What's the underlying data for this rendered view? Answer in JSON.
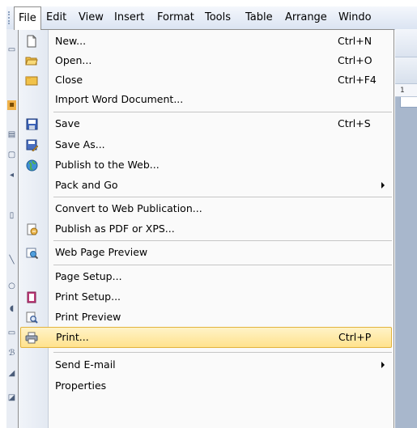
{
  "menubar": {
    "items": [
      {
        "label": "File"
      },
      {
        "label": "Edit"
      },
      {
        "label": "View"
      },
      {
        "label": "Insert"
      },
      {
        "label": "Format"
      },
      {
        "label": "Tools"
      },
      {
        "label": "Table"
      },
      {
        "label": "Arrange"
      },
      {
        "label": "Windo"
      }
    ]
  },
  "file_menu": {
    "items": [
      {
        "label": "New...",
        "shortcut": "Ctrl+N",
        "icon": "new-document-icon"
      },
      {
        "label": "Open...",
        "shortcut": "Ctrl+O",
        "icon": "open-folder-icon"
      },
      {
        "label": "Close",
        "shortcut": "Ctrl+F4",
        "icon": "close-folder-icon"
      },
      {
        "label": "Import Word Document...",
        "shortcut": ""
      },
      {
        "label": "Save",
        "shortcut": "Ctrl+S",
        "icon": "save-disk-icon"
      },
      {
        "label": "Save As...",
        "shortcut": "",
        "icon": "save-as-icon"
      },
      {
        "label": "Publish to the Web...",
        "shortcut": "",
        "icon": "globe-icon"
      },
      {
        "label": "Pack and Go",
        "shortcut": "",
        "submenu": true
      },
      {
        "label": "Convert to Web Publication...",
        "shortcut": ""
      },
      {
        "label": "Publish as PDF or XPS...",
        "shortcut": "",
        "icon": "pdf-export-icon"
      },
      {
        "label": "Web Page Preview",
        "shortcut": "",
        "icon": "web-preview-icon"
      },
      {
        "label": "Page Setup...",
        "shortcut": ""
      },
      {
        "label": "Print Setup...",
        "shortcut": "",
        "icon": "print-setup-icon"
      },
      {
        "label": "Print Preview",
        "shortcut": "",
        "icon": "print-preview-icon"
      },
      {
        "label": "Print...",
        "shortcut": "Ctrl+P",
        "icon": "printer-icon",
        "highlighted": true
      },
      {
        "label": "Send E-mail",
        "shortcut": "",
        "submenu": true
      },
      {
        "label": "Properties",
        "shortcut": ""
      }
    ]
  },
  "background": {
    "ruler_text": "1"
  },
  "colors": {
    "highlight_fill": "#ffe28d",
    "highlight_border": "#e2b33d",
    "menubar_bg": "#dbe4f2",
    "app_bg": "#a8b7cc"
  }
}
